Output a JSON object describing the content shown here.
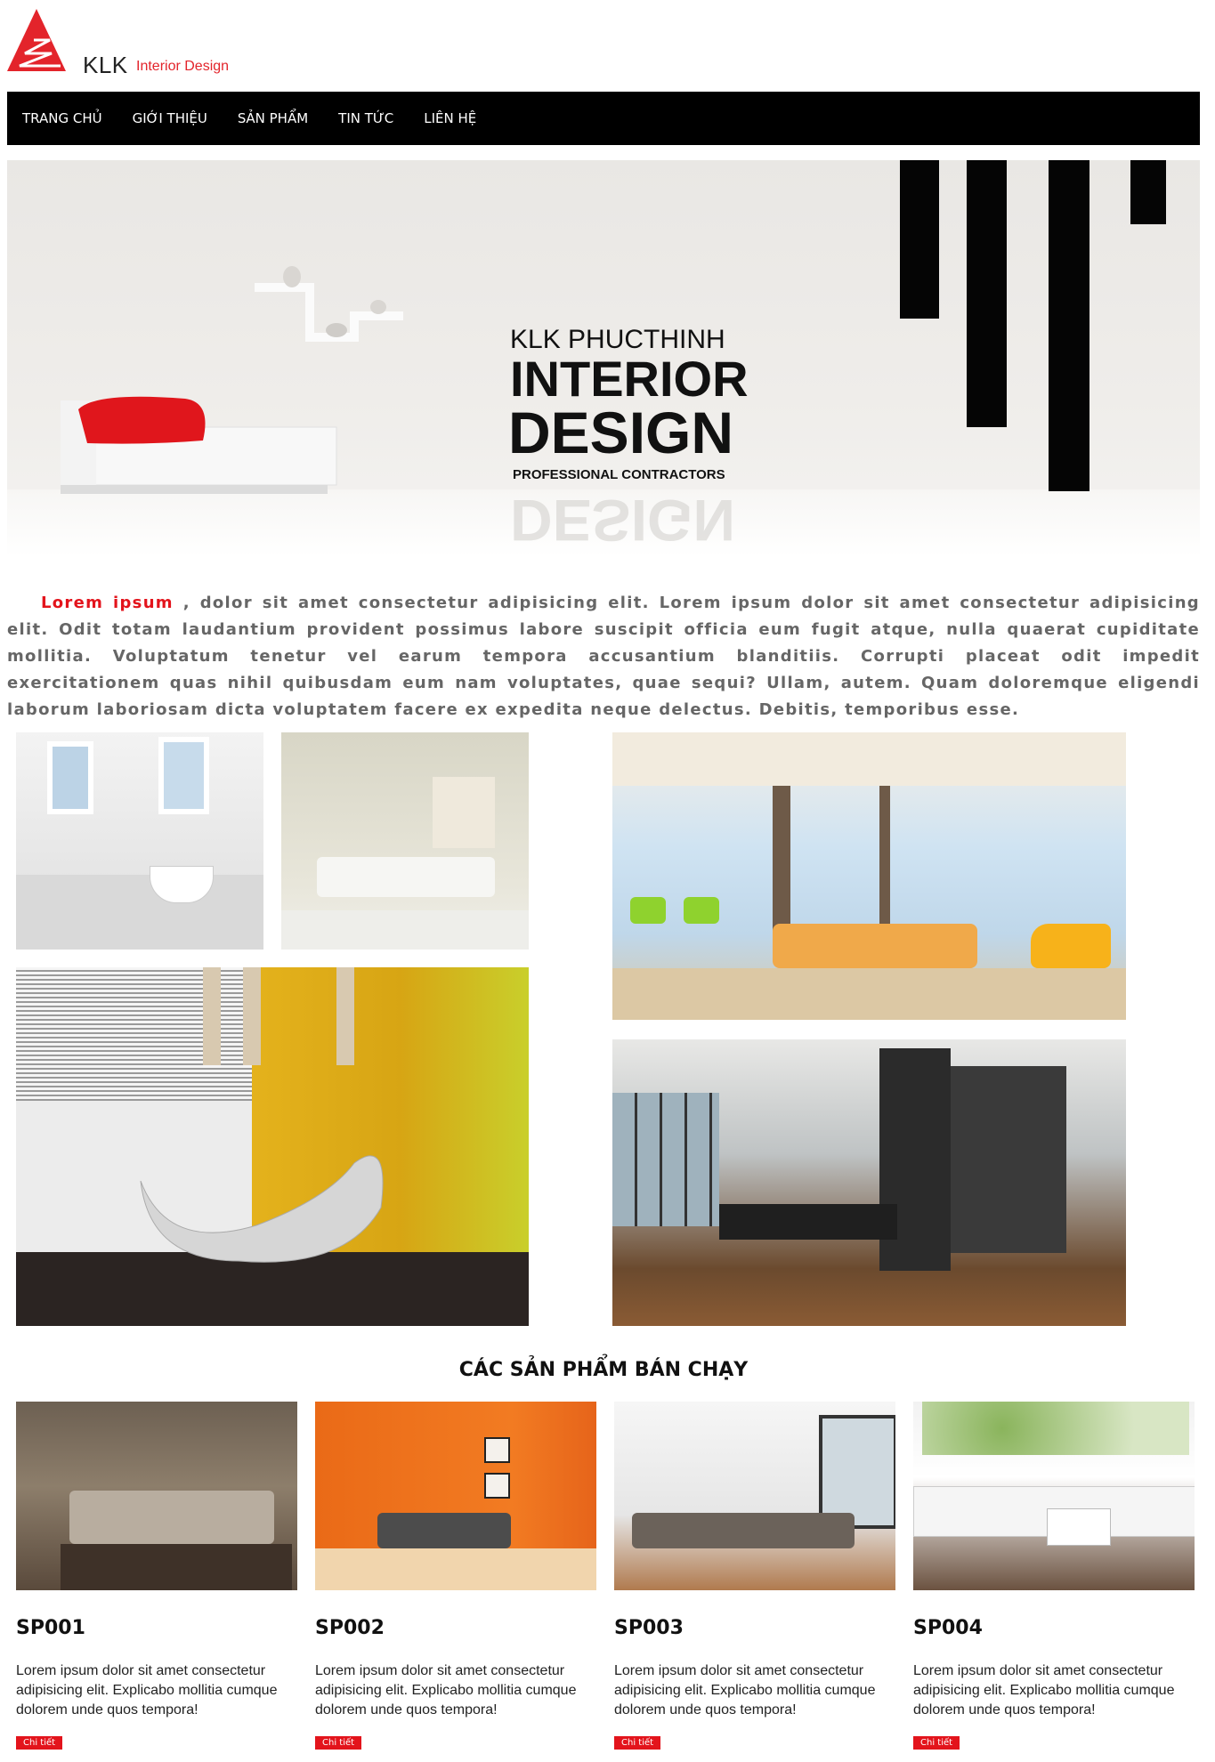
{
  "brand": {
    "name": "KLK",
    "tagline": "Interior Design",
    "accent_color": "#e3242b"
  },
  "nav": {
    "items": [
      "TRANG CHỦ",
      "GIỚI THIỆU",
      "SẢN PHẨM",
      "TIN TỨC",
      "LIÊN HỆ"
    ]
  },
  "hero": {
    "line1": "KLK PHUCTHINH",
    "line2": "INTERIOR",
    "line3": "DESIGN",
    "line4": "PROFESSIONAL CONTRACTORS",
    "reflection": "DESIGN"
  },
  "intro": {
    "highlight": "Lorem ipsum",
    "text": " , dolor sit amet consectetur adipisicing elit. Lorem ipsum dolor sit amet consectetur adipisicing elit. Odit totam laudantium provident possimus labore suscipit officia eum fugit atque, nulla quaerat cupiditate mollitia. Voluptatum tenetur vel earum tempora accusantium blanditiis. Corrupti placeat odit impedit exercitationem quas nihil quibusdam eum nam voluptates, quae sequi? Ullam, autem. Quam doloremque eligendi laborum laboriosam dicta voluptatem facere ex expedita neque delectus. Debitis, temporibus esse."
  },
  "bestsellers": {
    "title": "CÁC SẢN PHẨM BÁN CHẠY",
    "products": [
      {
        "code": "SP001",
        "desc": "Lorem ipsum dolor sit amet consectetur adipisicing elit. Explicabo mollitia cumque dolorem unde quos tempora!",
        "button": "Chi tiết"
      },
      {
        "code": "SP002",
        "desc": "Lorem ipsum dolor sit amet consectetur adipisicing elit. Explicabo mollitia cumque dolorem unde quos tempora!",
        "button": "Chi tiết"
      },
      {
        "code": "SP003",
        "desc": "Lorem ipsum dolor sit amet consectetur adipisicing elit. Explicabo mollitia cumque dolorem unde quos tempora!",
        "button": "Chi tiết"
      },
      {
        "code": "SP004",
        "desc": "Lorem ipsum dolor sit amet consectetur adipisicing elit. Explicabo mollitia cumque dolorem unde quos tempora!",
        "button": "Chi tiết"
      }
    ]
  }
}
